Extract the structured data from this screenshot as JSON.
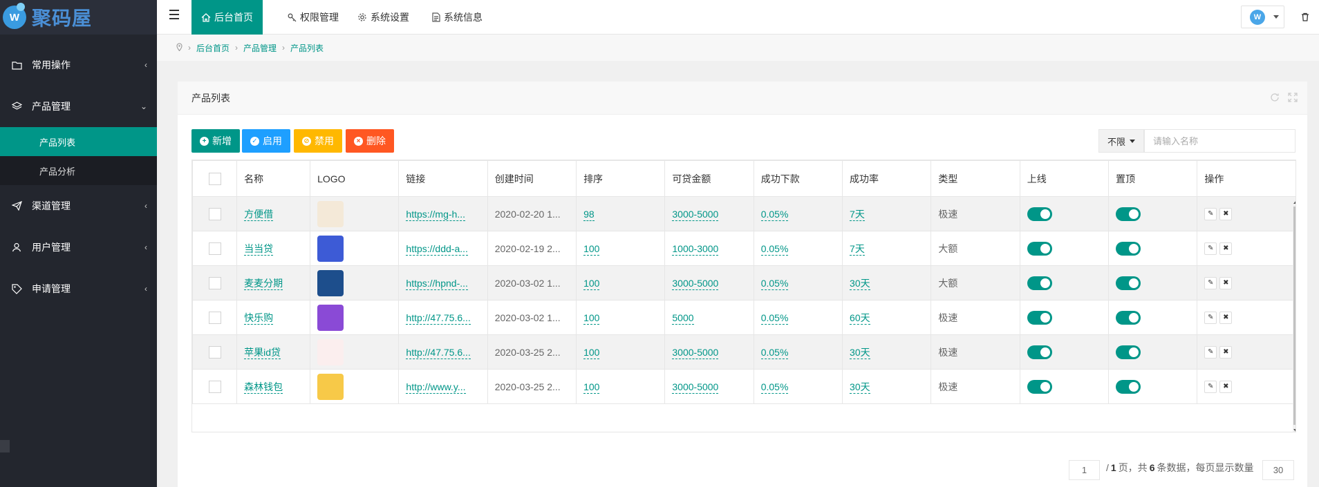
{
  "app": {
    "logo_text": "聚码屋",
    "logo_badge": "W"
  },
  "sidebar": {
    "items": [
      {
        "label": "常用操作",
        "icon": "folder-icon",
        "arrow": "‹"
      },
      {
        "label": "产品管理",
        "icon": "layers-icon",
        "arrow": "⌄"
      },
      {
        "label": "渠道管理",
        "icon": "send-icon",
        "arrow": "‹"
      },
      {
        "label": "用户管理",
        "icon": "user-icon",
        "arrow": "‹"
      },
      {
        "label": "申请管理",
        "icon": "tag-icon",
        "arrow": "‹"
      }
    ],
    "sub_items": [
      {
        "label": "产品列表"
      },
      {
        "label": "产品分析"
      }
    ]
  },
  "topbar": {
    "tabs": [
      {
        "label": "后台首页",
        "icon": "home-icon"
      },
      {
        "label": "权限管理",
        "icon": "key-icon"
      },
      {
        "label": "系统设置",
        "icon": "gear-icon"
      },
      {
        "label": "系统信息",
        "icon": "document-icon"
      }
    ],
    "user_avatar": "W"
  },
  "breadcrumb": {
    "items": [
      "后台首页",
      "产品管理",
      "产品列表"
    ]
  },
  "card": {
    "title": "产品列表"
  },
  "toolbar": {
    "add_label": "新增",
    "enable_label": "启用",
    "disable_label": "禁用",
    "delete_label": "删除",
    "filter_label": "不限",
    "search_placeholder": "请输入名称"
  },
  "table": {
    "headers": [
      "名称",
      "LOGO",
      "链接",
      "创建时间",
      "排序",
      "可贷金额",
      "成功下款",
      "成功率",
      "类型",
      "上线",
      "置顶",
      "操作"
    ],
    "rows": [
      {
        "name": "方便借",
        "link": "https://mg-h...",
        "created": "2020-02-20 1...",
        "sort": "98",
        "amount": "3000-5000",
        "success": "0.05%",
        "rate": "7天",
        "type": "极速",
        "logo_color": "#f4e9d8"
      },
      {
        "name": "当当贷",
        "link": "https://ddd-a...",
        "created": "2020-02-19 2...",
        "sort": "100",
        "amount": "1000-3000",
        "success": "0.05%",
        "rate": "7天",
        "type": "大额",
        "logo_color": "#3d5bd6"
      },
      {
        "name": "麦麦分期",
        "link": "https://hpnd-...",
        "created": "2020-03-02 1...",
        "sort": "100",
        "amount": "3000-5000",
        "success": "0.05%",
        "rate": "30天",
        "type": "大额",
        "logo_color": "#1d4e8c"
      },
      {
        "name": "快乐购",
        "link": "http://47.75.6...",
        "created": "2020-03-02 1...",
        "sort": "100",
        "amount": "5000",
        "success": "0.05%",
        "rate": "60天",
        "type": "极速",
        "logo_color": "#8a4ad6"
      },
      {
        "name": "苹果id贷",
        "link": "http://47.75.6...",
        "created": "2020-03-25 2...",
        "sort": "100",
        "amount": "3000-5000",
        "success": "0.05%",
        "rate": "30天",
        "type": "极速",
        "logo_color": "#fbeeee"
      },
      {
        "name": "森林钱包",
        "link": "http://www.y...",
        "created": "2020-03-25 2...",
        "sort": "100",
        "amount": "3000-5000",
        "success": "0.05%",
        "rate": "30天",
        "type": "极速",
        "logo_color": "#f7c948"
      }
    ]
  },
  "pagination": {
    "page": "1",
    "total_pages": "1",
    "page_text": "页，共",
    "count": "6",
    "count_text": "条数据，每页显示数量",
    "page_size": "30"
  },
  "colors": {
    "accent": "#009688",
    "info": "#1e9fff",
    "warn": "#ffb800",
    "danger": "#ff5722",
    "sidebar": "#23262e"
  }
}
